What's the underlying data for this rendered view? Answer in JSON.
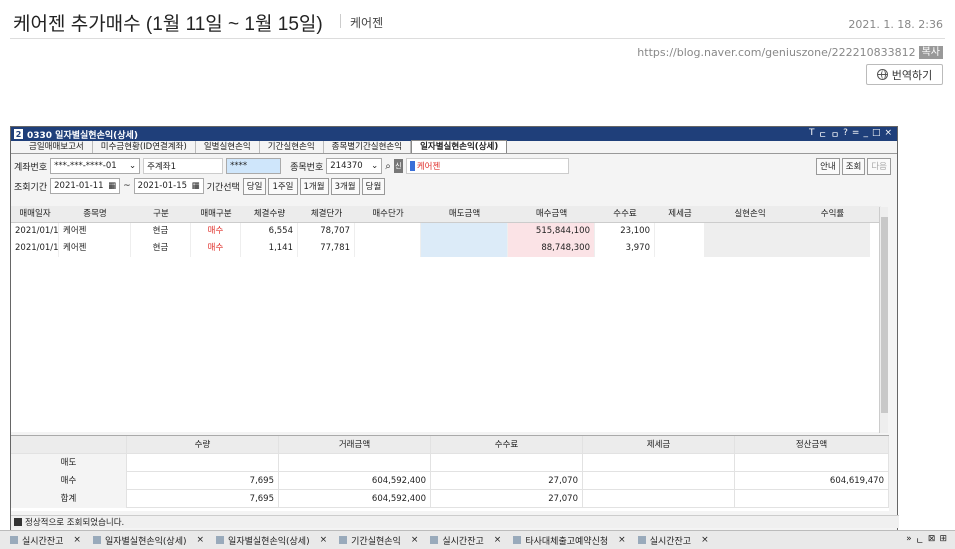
{
  "blog": {
    "title": "케어젠 추가매수 (1월 11일 ~ 1월 15일)",
    "category": "케어젠",
    "date": "2021. 1. 18. 2:36",
    "url": "https://blog.naver.com/geniuszone/222210833812",
    "copy_label": "복사",
    "translate_label": "번역하기"
  },
  "window": {
    "number": "2",
    "title": "0330 일자별실현손익(상세)",
    "controls": [
      "T",
      "ㄷ",
      "ㅁ",
      "?",
      "=",
      "_",
      "□",
      "×"
    ],
    "tabs": [
      "금일매매보고서",
      "미수금현황(ID연결계좌)",
      "일별실현손익",
      "기간실현손익",
      "종목별기간실현손익",
      "일자별실현손익(상세)"
    ],
    "account_label": "계좌번호",
    "account_value": "***-***-****-01",
    "account_name": "주계좌1",
    "password": "****",
    "stock_code_label": "종목번호",
    "stock_code": "214370",
    "stock_name": "케어젠",
    "guide_btn": "안내",
    "query_btn": "조회",
    "next_btn": "다음",
    "period_label": "조회기간",
    "date_from": "2021-01-11",
    "date_to": "2021-01-15",
    "tilde": "~",
    "period_select_label": "기간선택",
    "period_buttons": [
      "당일",
      "1주일",
      "1개월",
      "3개월",
      "당월"
    ],
    "columns": [
      "매매일자",
      "종목명",
      "구분",
      "매매구분",
      "체결수량",
      "체결단가",
      "매수단가",
      "매도금액",
      "매수금액",
      "수수료",
      "제세금",
      "실현손익",
      "수익률"
    ],
    "rows": [
      [
        "2021/01/11",
        "케어젠",
        "현금",
        "매수",
        "6,554",
        "78,707",
        "",
        "",
        "515,844,100",
        "23,100",
        "",
        "",
        ""
      ],
      [
        "2021/01/13",
        "케어젠",
        "현금",
        "매수",
        "1,141",
        "77,781",
        "",
        "",
        "88,748,300",
        "3,970",
        "",
        "",
        ""
      ]
    ],
    "summary_columns": [
      "수량",
      "거래금액",
      "수수료",
      "제세금",
      "정산금액"
    ],
    "summary_rows": [
      [
        "매도",
        "",
        "",
        "",
        "",
        ""
      ],
      [
        "매수",
        "7,695",
        "604,592,400",
        "27,070",
        "",
        "604,619,470"
      ],
      [
        "합계",
        "7,695",
        "604,592,400",
        "27,070",
        "",
        ""
      ]
    ],
    "status": "정상적으로 조회되었습니다."
  },
  "taskbar": {
    "tabs": [
      "실시간잔고",
      "일자별실현손익(상세)",
      "일자별실현손익(상세)",
      "기간실현손익",
      "실시간잔고",
      "타사대체출고예약신청",
      "실시간잔고"
    ],
    "right": [
      "»",
      "ㄴ",
      "⊠",
      "⊞"
    ]
  },
  "colors": {
    "titlebar": "#1f3f7a",
    "buy_text": "#e0322d",
    "sell_cell": "#dcebf8",
    "buy_cell": "#fbe3e6"
  }
}
